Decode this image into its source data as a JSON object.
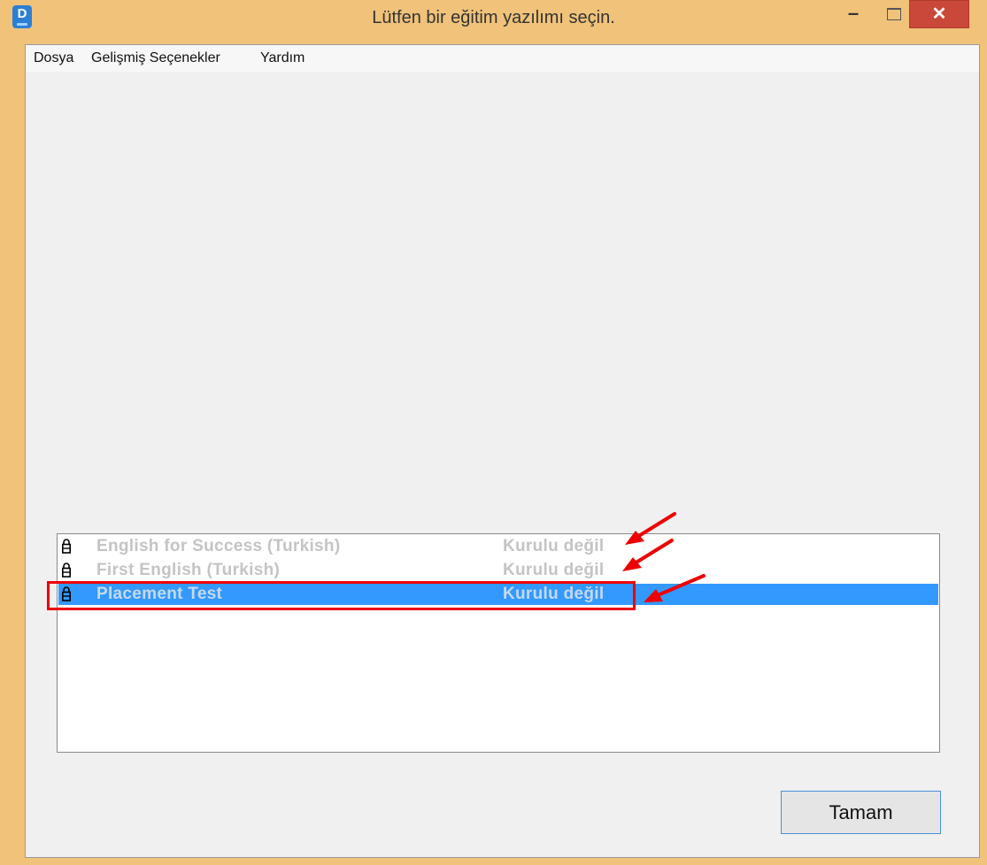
{
  "window": {
    "title": "Lütfen bir eğitim yazılımı seçin.",
    "icon_letter": "D",
    "controls": {
      "minimize": "–",
      "maximize": "",
      "close": "✕"
    }
  },
  "menu": {
    "items": [
      {
        "label": "Dosya"
      },
      {
        "label": "Gelişmiş Seçenekler"
      },
      {
        "label": "Yardım"
      }
    ]
  },
  "courses": [
    {
      "name": "English for Success  (Turkish)",
      "status": "Kurulu değil",
      "selected": false
    },
    {
      "name": "First English  (Turkish)",
      "status": "Kurulu değil",
      "selected": false
    },
    {
      "name": "Placement Test",
      "status": "Kurulu değil",
      "selected": true
    }
  ],
  "buttons": {
    "ok_label": "Tamam"
  },
  "colors": {
    "selection": "#3399ff",
    "annotation": "#ee0000",
    "disabled_text": "#c4c4c4",
    "frame": "#f0c27a",
    "close_button": "#c9483a"
  },
  "icons": {
    "course_item": "lock-icon"
  }
}
